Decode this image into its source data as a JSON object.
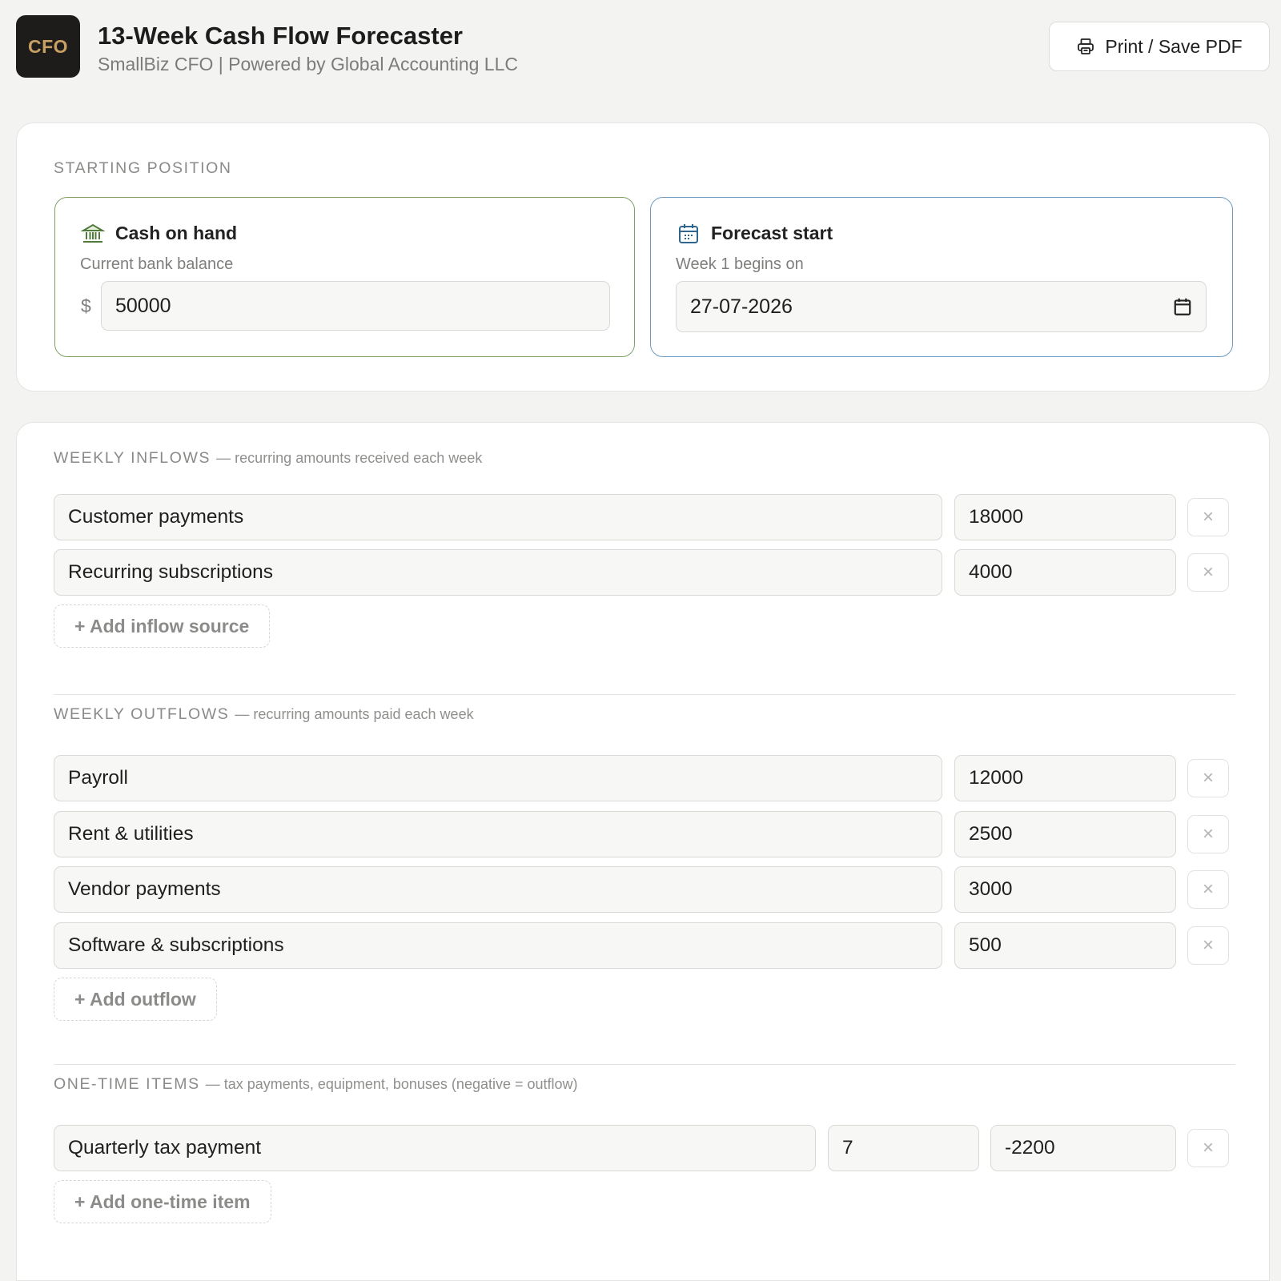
{
  "header": {
    "logo_text": "CFO",
    "title": "13-Week Cash Flow Forecaster",
    "subtitle": "SmallBiz CFO | Powered by Global Accounting LLC",
    "print_label": "Print / Save PDF"
  },
  "starting": {
    "section_label": "STARTING POSITION",
    "cash": {
      "title": "Cash on hand",
      "subtitle": "Current bank balance",
      "currency": "$",
      "value": "50000",
      "icon": "bank-icon"
    },
    "forecast": {
      "title": "Forecast start",
      "subtitle": "Week 1 begins on",
      "value": "27-07-2026",
      "icon": "calendar-icon"
    }
  },
  "inflows": {
    "label": "WEEKLY INFLOWS",
    "hint": "— recurring amounts received each week",
    "items": [
      {
        "name": "Customer payments",
        "amount": "18000"
      },
      {
        "name": "Recurring subscriptions",
        "amount": "4000"
      }
    ],
    "add_label": "+ Add inflow source"
  },
  "outflows": {
    "label": "WEEKLY OUTFLOWS",
    "hint": "— recurring amounts paid each week",
    "items": [
      {
        "name": "Payroll",
        "amount": "12000"
      },
      {
        "name": "Rent & utilities",
        "amount": "2500"
      },
      {
        "name": "Vendor payments",
        "amount": "3000"
      },
      {
        "name": "Software & subscriptions",
        "amount": "500"
      }
    ],
    "add_label": "+ Add outflow"
  },
  "onetime": {
    "label": "ONE-TIME ITEMS",
    "hint": "— tax payments, equipment, bonuses (negative = outflow)",
    "items": [
      {
        "name": "Quarterly tax payment",
        "week": "7",
        "amount": "-2200"
      }
    ],
    "add_label": "+ Add one-time item"
  },
  "remove_symbol": "×",
  "colors": {
    "accent_green": "#7da165",
    "accent_blue": "#6f9bc0",
    "logo_bg": "#1e1c1a",
    "logo_text": "#c9a063"
  }
}
